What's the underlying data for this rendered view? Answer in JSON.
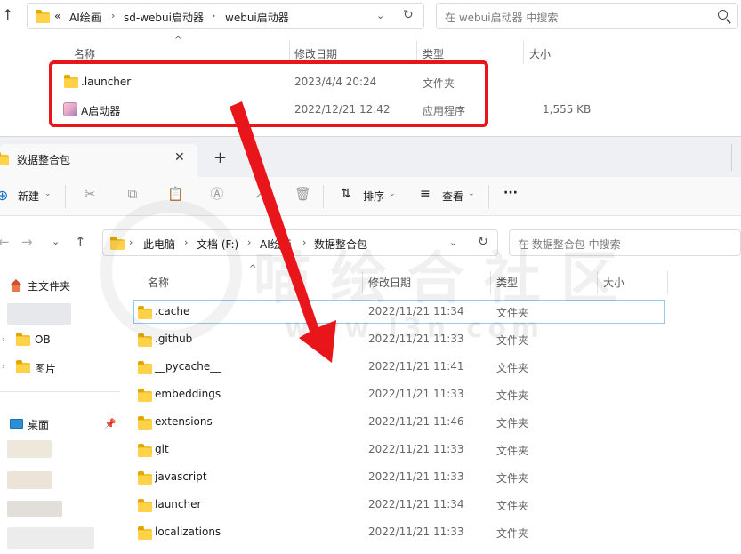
{
  "back_window": {
    "breadcrumb_overflow": "«",
    "breadcrumb": [
      "AI绘画",
      "sd-webui启动器",
      "webui启动器"
    ],
    "search_placeholder": "在 webui启动器 中搜索",
    "columns": [
      "名称",
      "修改日期",
      "类型",
      "大小"
    ],
    "rows": [
      {
        "name": ".launcher",
        "date": "2023/4/4 20:24",
        "type": "文件夹",
        "size": "",
        "icon": "folder-icon"
      },
      {
        "name": "A启动器",
        "date": "2022/12/21 12:42",
        "type": "应用程序",
        "size": "1,555 KB",
        "icon": "app-icon"
      }
    ]
  },
  "front_window": {
    "tab_title": "数据整合包",
    "toolbar": {
      "new": "新建",
      "sort": "排序",
      "view": "查看",
      "more": "···"
    },
    "breadcrumb": [
      "此电脑",
      "文档 (F:)",
      "AI绘画",
      "数据整合包"
    ],
    "search_placeholder": "在 数据整合包 中搜索",
    "sidebar": {
      "home": "主文件夹",
      "ob": "OB",
      "pictures": "图片",
      "desktop": "桌面"
    },
    "columns": [
      "名称",
      "修改日期",
      "类型",
      "大小"
    ],
    "rows": [
      {
        "name": ".cache",
        "date": "2022/11/21 11:34",
        "type": "文件夹"
      },
      {
        "name": ".github",
        "date": "2022/11/21 11:33",
        "type": "文件夹"
      },
      {
        "name": "__pycache__",
        "date": "2022/11/21 11:41",
        "type": "文件夹"
      },
      {
        "name": "embeddings",
        "date": "2022/11/21 11:33",
        "type": "文件夹"
      },
      {
        "name": "extensions",
        "date": "2022/11/21 11:46",
        "type": "文件夹"
      },
      {
        "name": "git",
        "date": "2022/11/21 11:33",
        "type": "文件夹"
      },
      {
        "name": "javascript",
        "date": "2022/11/21 11:33",
        "type": "文件夹"
      },
      {
        "name": "launcher",
        "date": "2022/11/21 11:34",
        "type": "文件夹"
      },
      {
        "name": "localizations",
        "date": "2022/11/21 11:33",
        "type": "文件夹"
      }
    ]
  },
  "watermark": {
    "main": "喵 绘 合 社 区",
    "sub": "www.l3n.com"
  },
  "colors": {
    "highlight": "#e8151a",
    "folder": "#ffd24a",
    "selection_border": "#99c8ee"
  }
}
